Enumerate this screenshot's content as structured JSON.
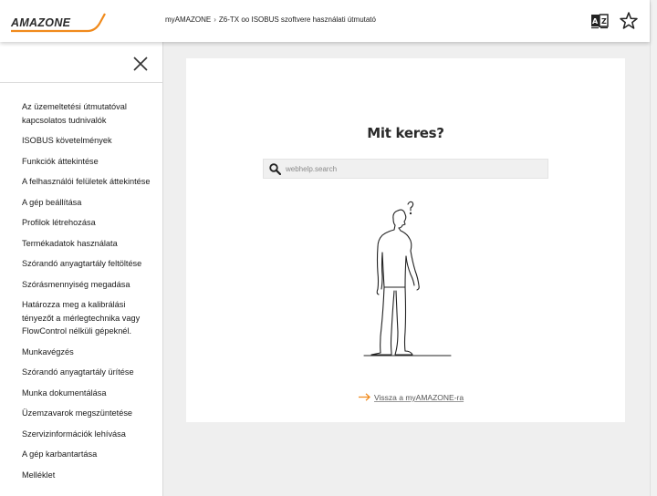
{
  "brand": {
    "logo_text": "AMAZONE",
    "accent_color": "#f08a1c"
  },
  "header": {
    "breadcrumb": [
      "myAMAZONE",
      "Z6-TX oo ISOBUS szoftvere használati útmutató"
    ],
    "breadcrumb_separator": "›",
    "icons": [
      "dictionary-icon",
      "star-icon"
    ]
  },
  "sidebar": {
    "close_icon": "close-icon",
    "items": [
      "Az üzemeltetési útmutatóval kapcsolatos tudnivalók",
      "ISOBUS követelmények",
      "Funkciók áttekintése",
      "A felhasználói felületek áttekintése",
      "A gép beállítása",
      "Profilok létrehozása",
      "Termékadatok használata",
      "Szórandó anyagtartály feltöltése",
      "Szórásmennyiség megadása",
      "Határozza meg a kalibrálási tényezőt a mérlegtechnika vagy FlowControl nélküli gépeknél.",
      "Munkavégzés",
      "Szórandó anyagtartály ürítése",
      "Munka dokumentálása",
      "Üzemzavarok megszüntetése",
      "Szervizinformációk lehívása",
      "A gép karbantartása",
      "Melléklet"
    ]
  },
  "main": {
    "title": "Mit keres?",
    "search": {
      "placeholder": "webhelp.search",
      "value": "",
      "icon": "search-icon"
    },
    "illustration": "man-looking-up-question-icon",
    "back_link": "Vissza a myAMAZONE-ra"
  }
}
